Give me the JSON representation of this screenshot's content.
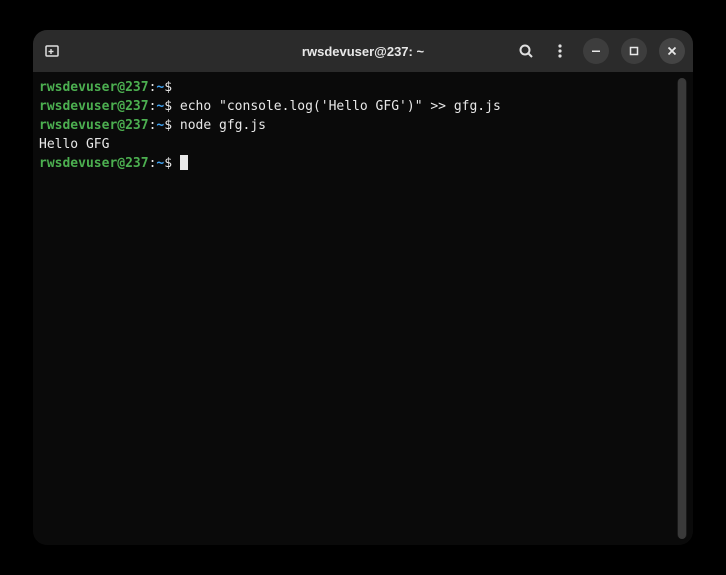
{
  "titlebar": {
    "title": "rwsdevuser@237: ~"
  },
  "terminal": {
    "lines": [
      {
        "user": "rwsdevuser@237",
        "path": "~",
        "symbol": "$",
        "cmd": ""
      },
      {
        "user": "rwsdevuser@237",
        "path": "~",
        "symbol": "$",
        "cmd": "echo \"console.log('Hello GFG')\" >> gfg.js"
      },
      {
        "user": "rwsdevuser@237",
        "path": "~",
        "symbol": "$",
        "cmd": "node gfg.js"
      },
      {
        "output": "Hello GFG"
      },
      {
        "user": "rwsdevuser@237",
        "path": "~",
        "symbol": "$",
        "cmd": "",
        "cursor": true
      }
    ]
  }
}
